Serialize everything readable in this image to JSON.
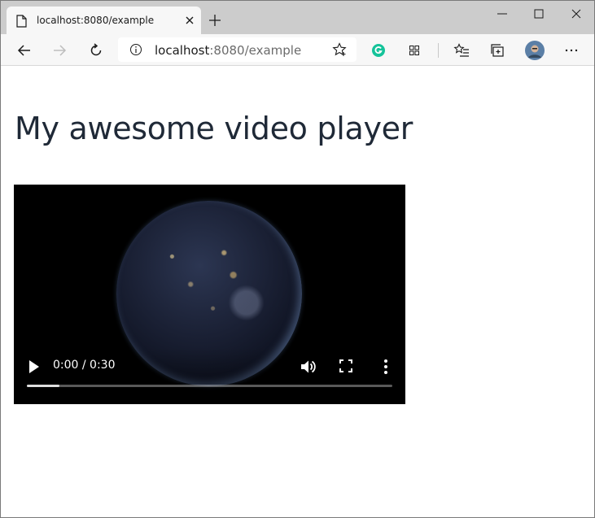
{
  "browser": {
    "tab_title": "localhost:8080/example",
    "url_host": "localhost",
    "url_path": ":8080/example",
    "icons": [
      "page-icon",
      "close-icon",
      "plus-icon",
      "minimize-icon",
      "maximize-icon",
      "close-window-icon",
      "back-arrow-icon",
      "forward-arrow-icon",
      "refresh-icon",
      "info-icon",
      "star-icon",
      "grammarly-icon",
      "extensions-icon",
      "favorites-icon",
      "collections-icon",
      "profile-avatar",
      "more-icon"
    ],
    "grammarly_color": "#15c39a"
  },
  "page": {
    "heading": "My awesome video player"
  },
  "video": {
    "time_display": "0:00 / 0:30",
    "progress_fraction": 0.09
  }
}
